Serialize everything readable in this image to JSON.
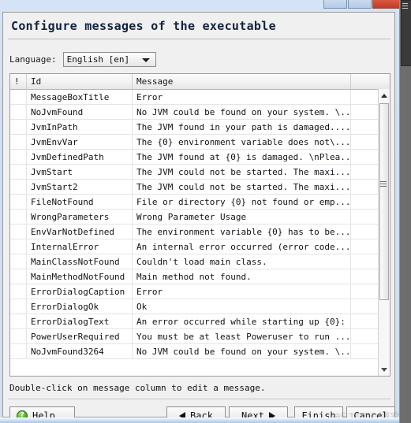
{
  "window": {
    "frame_color": "#cfe0f2",
    "buttons": [
      {
        "name": "minimize",
        "label": ""
      },
      {
        "name": "maximize",
        "label": ""
      },
      {
        "name": "close",
        "label": ""
      }
    ]
  },
  "dialog": {
    "title": "Configure messages of the executable",
    "language": {
      "label": "Language:",
      "selected": "English [en]",
      "options": [
        "English [en]"
      ]
    },
    "hint": "Double-click on message column to edit a message."
  },
  "table": {
    "columns": [
      "!",
      "Id",
      "Message",
      ""
    ],
    "rows": [
      {
        "flag": "",
        "id": "MessageBoxTitle",
        "message": "Error"
      },
      {
        "flag": "",
        "id": "NoJvmFound",
        "message": "No JVM could be found on your system. \\..."
      },
      {
        "flag": "",
        "id": "JvmInPath",
        "message": "The JVM found in your path is damaged...."
      },
      {
        "flag": "",
        "id": "JvmEnvVar",
        "message": "The {0} environment variable does not\\..."
      },
      {
        "flag": "",
        "id": "JvmDefinedPath",
        "message": "The JVM found at {0} is damaged. \\nPlea..."
      },
      {
        "flag": "",
        "id": "JvmStart",
        "message": "The JVM could not be started. The maxi..."
      },
      {
        "flag": "",
        "id": "JvmStart2",
        "message": "The JVM could not be started. The maxi..."
      },
      {
        "flag": "",
        "id": "FileNotFound",
        "message": "File or directory {0} not found or emp..."
      },
      {
        "flag": "",
        "id": "WrongParameters",
        "message": "Wrong Parameter Usage"
      },
      {
        "flag": "",
        "id": "EnvVarNotDefined",
        "message": "The environment variable {0} has to be..."
      },
      {
        "flag": "",
        "id": "InternalError",
        "message": "An internal error occurred (error code..."
      },
      {
        "flag": "",
        "id": "MainClassNotFound",
        "message": "Couldn't load main class."
      },
      {
        "flag": "",
        "id": "MainMethodNotFound",
        "message": "Main method not found."
      },
      {
        "flag": "",
        "id": "ErrorDialogCaption",
        "message": "Error"
      },
      {
        "flag": "",
        "id": "ErrorDialogOk",
        "message": "Ok"
      },
      {
        "flag": "",
        "id": "ErrorDialogText",
        "message": "An error occurred while starting up {0}:"
      },
      {
        "flag": "",
        "id": "PowerUserRequired",
        "message": "You must be at least Poweruser to run ..."
      },
      {
        "flag": "",
        "id": "NoJvmFound3264",
        "message": "No JVM could be found on your system. \\..."
      }
    ]
  },
  "footer": {
    "help_label": "Help",
    "back_label": "Back",
    "next_label": "Next",
    "finish_label": "Finish",
    "cancel_label": "Cancel",
    "help_icon_glyph": "?"
  },
  "watermark": {
    "text": "@51CTO博客"
  }
}
